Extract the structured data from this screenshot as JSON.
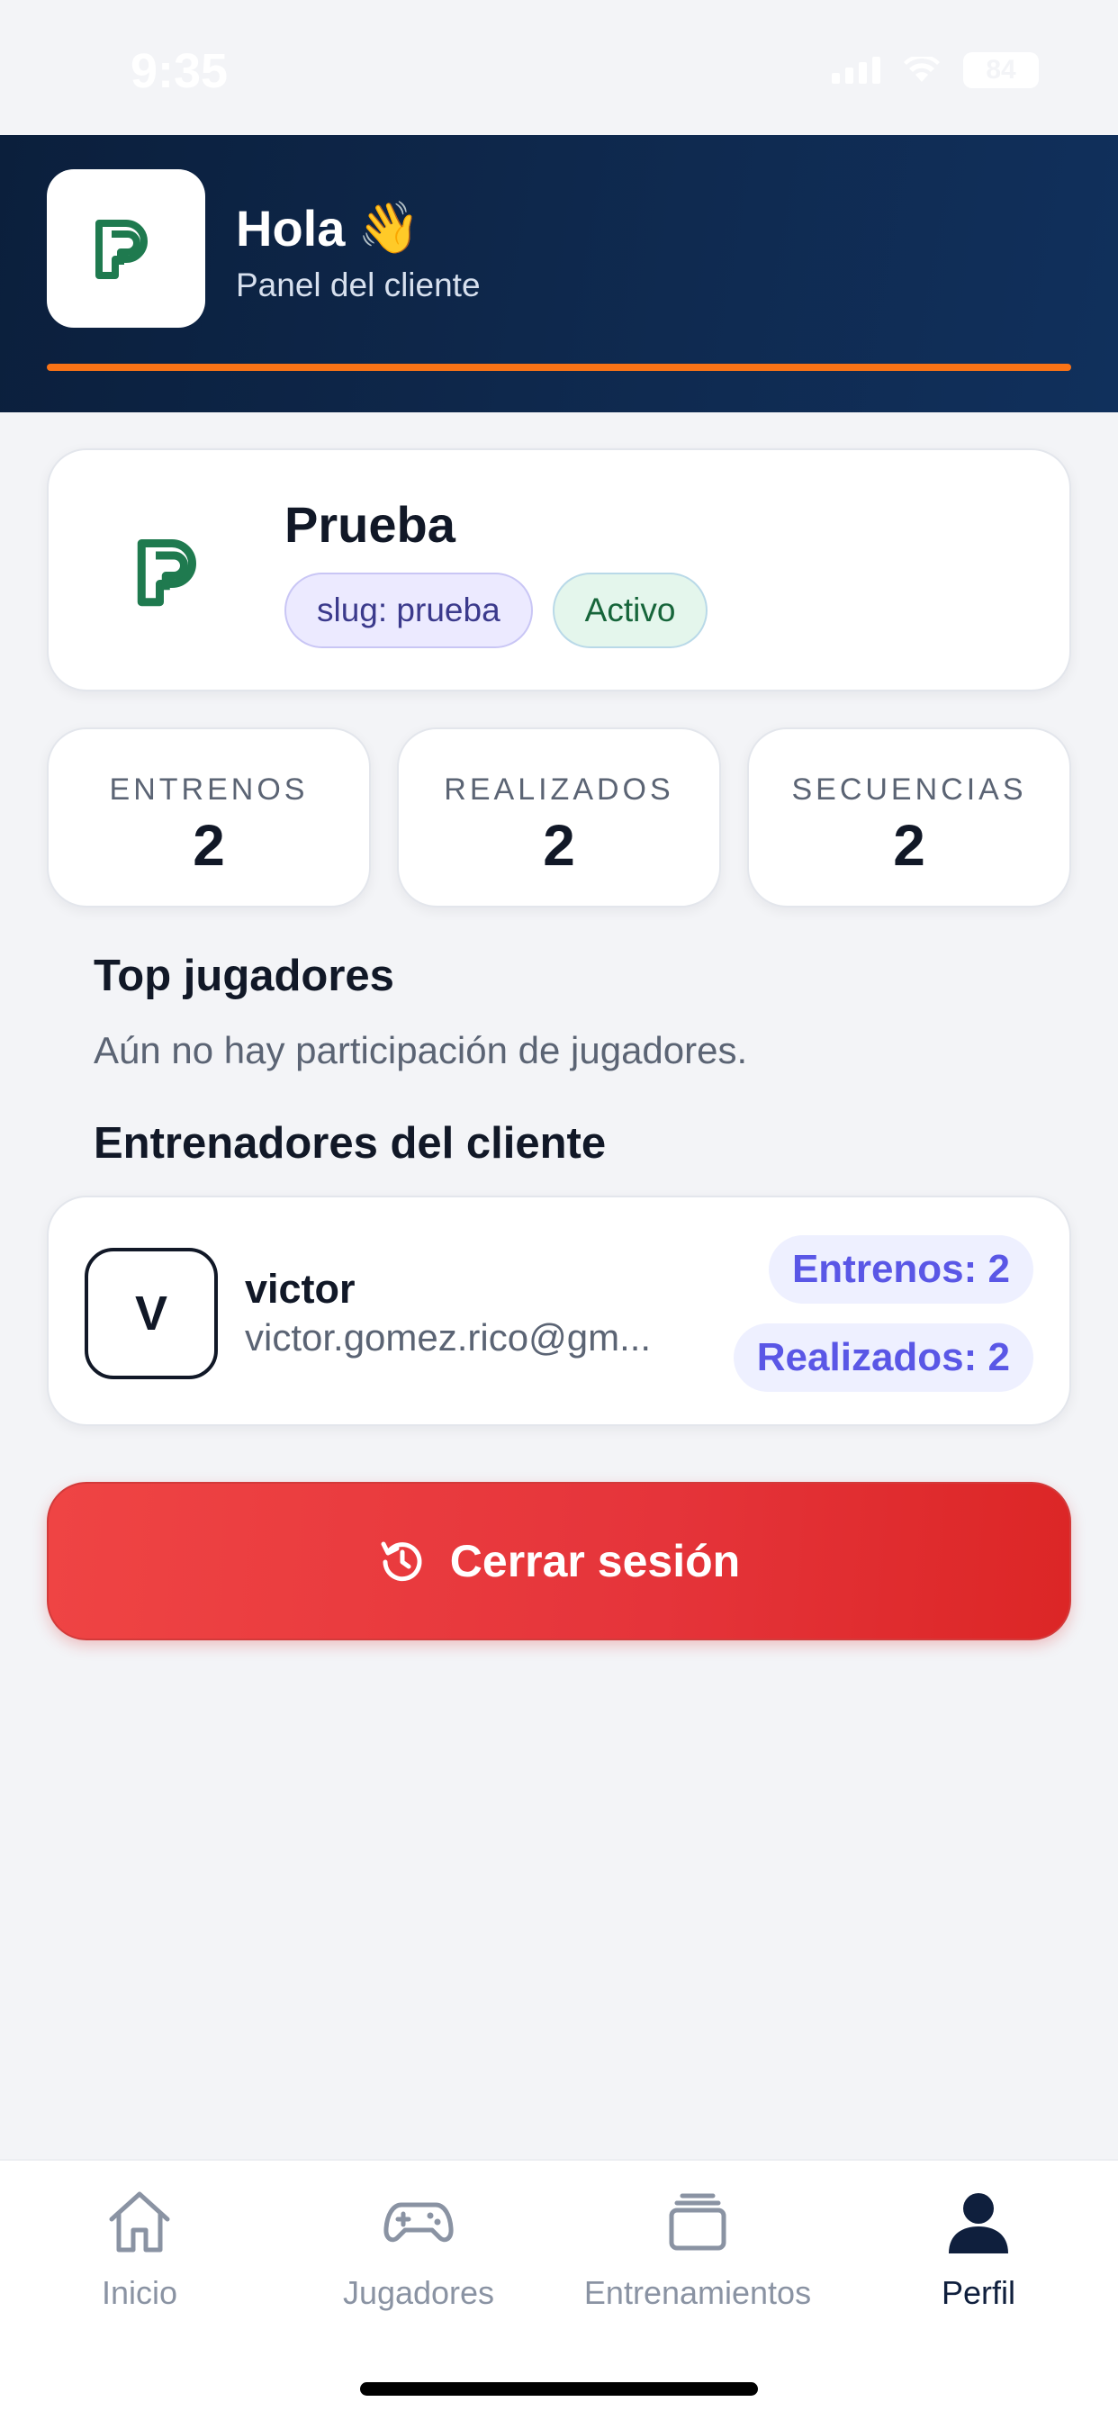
{
  "status_bar": {
    "time": "9:35",
    "battery": "84",
    "icons": [
      "signal-icon",
      "wifi-icon",
      "battery-icon"
    ]
  },
  "header": {
    "greeting": "Hola",
    "wave": "👋",
    "subtitle": "Panel del cliente",
    "accent_color": "#f97316",
    "background_color": "#0b1f3c"
  },
  "client": {
    "name": "Prueba",
    "slug_badge": "slug: prueba",
    "status_badge": "Activo",
    "logo_color": "#1f7a4f"
  },
  "stats": [
    {
      "label": "ENTRENOS",
      "value": "2"
    },
    {
      "label": "REALIZADOS",
      "value": "2"
    },
    {
      "label": "SECUENCIAS",
      "value": "2"
    }
  ],
  "top_players": {
    "title": "Top jugadores",
    "empty_text": "Aún no hay participación de jugadores."
  },
  "coaches": {
    "title": "Entrenadores del cliente",
    "items": [
      {
        "initial": "V",
        "name": "victor",
        "email": "victor.gomez.rico@gm...",
        "trainings_pill": "Entrenos: 2",
        "done_pill": "Realizados: 2"
      }
    ]
  },
  "logout": {
    "label": "Cerrar sesión",
    "icon": "logout-refresh-icon",
    "color": "#ef4444"
  },
  "bottom_nav": {
    "items": [
      {
        "label": "Inicio",
        "icon": "home-icon",
        "active": false
      },
      {
        "label": "Jugadores",
        "icon": "gamepad-icon",
        "active": false
      },
      {
        "label": "Entrenamientos",
        "icon": "stack-icon",
        "active": false
      },
      {
        "label": "Perfil",
        "icon": "user-icon",
        "active": true
      }
    ]
  }
}
